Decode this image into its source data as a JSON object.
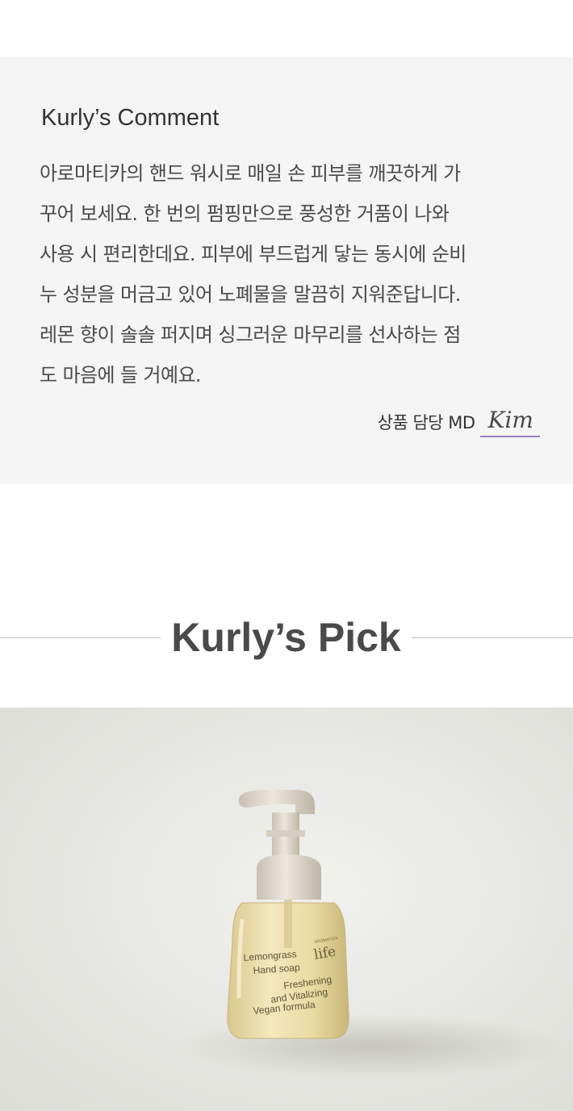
{
  "comment": {
    "title": "Kurly’s Comment",
    "body_lines": [
      "아로마티카의 핸드 워시로 매일 손 피부를 깨끗하게 가",
      "꾸어 보세요. 한 번의 펌핑만으로 풍성한 거품이 나와",
      "사용 시 편리한데요. 피부에 부드럽게 닿는 동시에 순비",
      "누 성분을 머금고 있어 노폐물을 말끔히 지워준답니다.",
      "레몬 향이 솔솔 퍼지며 싱그러운 마무리를 선사하는 점",
      "도 마음에 들 거예요."
    ],
    "md_label": "상품 담당 MD",
    "md_signature": "Kim"
  },
  "pick": {
    "title": "Kurly’s Pick"
  },
  "product": {
    "label_brand_small": "AROMATICA",
    "label_brand": "life",
    "label_name_1": "Lemongrass",
    "label_name_2": "Hand soap",
    "label_desc_1": "Freshening",
    "label_desc_2": "and Vitalizing",
    "label_desc_3": "Vegan formula"
  },
  "colors": {
    "comment_bg": "#f5f5f5",
    "signature_underline": "#9a7cc0",
    "divider": "#bdbdbd",
    "photo_bg": "#e6e6e2"
  }
}
